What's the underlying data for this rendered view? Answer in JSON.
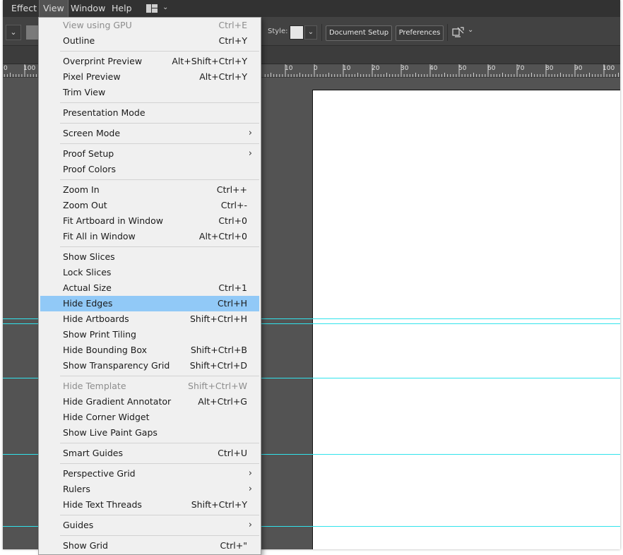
{
  "colors": {
    "app_bg": "#535353",
    "menubar_bg": "#323232",
    "menu_bg": "#f0f0f0",
    "menu_highlight": "#91c9f7",
    "guide": "#31e3ec",
    "artboard": "#ffffff"
  },
  "menubar": {
    "items": [
      "Effect",
      "View",
      "Window",
      "Help"
    ],
    "active": "View",
    "workspace_icon": "workspace-layout-icon",
    "workspace_chevron": "⌄"
  },
  "controlbar": {
    "left_dropdown_glyph": "⌄",
    "style_label": "Style:",
    "style_dropdown_glyph": "⌄",
    "document_setup": "Document Setup",
    "preferences": "Preferences",
    "arrange_icon": "arrange-documents-icon",
    "arrange_chevron": "⌄"
  },
  "ruler": {
    "left_labels": [
      "0",
      "100"
    ],
    "labels": [
      "10",
      "0",
      "10",
      "20",
      "30",
      "40",
      "50",
      "60",
      "70",
      "80",
      "90",
      "100"
    ]
  },
  "view_menu": {
    "submenu_glyph": "›",
    "groups": [
      [
        {
          "label": "View using GPU",
          "shortcut": "Ctrl+E",
          "disabled": true
        },
        {
          "label": "Outline",
          "shortcut": "Ctrl+Y"
        }
      ],
      [
        {
          "label": "Overprint Preview",
          "shortcut": "Alt+Shift+Ctrl+Y"
        },
        {
          "label": "Pixel Preview",
          "shortcut": "Alt+Ctrl+Y"
        },
        {
          "label": "Trim View",
          "shortcut": ""
        }
      ],
      [
        {
          "label": "Presentation Mode",
          "shortcut": ""
        }
      ],
      [
        {
          "label": "Screen Mode",
          "shortcut": "",
          "submenu": true
        }
      ],
      [
        {
          "label": "Proof Setup",
          "shortcut": "",
          "submenu": true
        },
        {
          "label": "Proof Colors",
          "shortcut": ""
        }
      ],
      [
        {
          "label": "Zoom In",
          "shortcut": "Ctrl++"
        },
        {
          "label": "Zoom Out",
          "shortcut": "Ctrl+-"
        },
        {
          "label": "Fit Artboard in Window",
          "shortcut": "Ctrl+0"
        },
        {
          "label": "Fit All in Window",
          "shortcut": "Alt+Ctrl+0"
        }
      ],
      [
        {
          "label": "Show Slices",
          "shortcut": ""
        },
        {
          "label": "Lock Slices",
          "shortcut": ""
        },
        {
          "label": "Actual Size",
          "shortcut": "Ctrl+1"
        },
        {
          "label": "Hide Edges",
          "shortcut": "Ctrl+H",
          "highlighted": true
        },
        {
          "label": "Hide Artboards",
          "shortcut": "Shift+Ctrl+H"
        },
        {
          "label": "Show Print Tiling",
          "shortcut": ""
        },
        {
          "label": "Hide Bounding Box",
          "shortcut": "Shift+Ctrl+B"
        },
        {
          "label": "Show Transparency Grid",
          "shortcut": "Shift+Ctrl+D"
        }
      ],
      [
        {
          "label": "Hide Template",
          "shortcut": "Shift+Ctrl+W",
          "disabled": true
        },
        {
          "label": "Hide Gradient Annotator",
          "shortcut": "Alt+Ctrl+G"
        },
        {
          "label": "Hide Corner Widget",
          "shortcut": ""
        },
        {
          "label": "Show Live Paint Gaps",
          "shortcut": ""
        }
      ],
      [
        {
          "label": "Smart Guides",
          "shortcut": "Ctrl+U"
        }
      ],
      [
        {
          "label": "Perspective Grid",
          "shortcut": "",
          "submenu": true
        },
        {
          "label": "Rulers",
          "shortcut": "",
          "submenu": true
        },
        {
          "label": "Hide Text Threads",
          "shortcut": "Shift+Ctrl+Y"
        }
      ],
      [
        {
          "label": "Guides",
          "shortcut": "",
          "submenu": true
        }
      ],
      [
        {
          "label": "Show Grid",
          "shortcut": "Ctrl+\""
        }
      ]
    ]
  }
}
